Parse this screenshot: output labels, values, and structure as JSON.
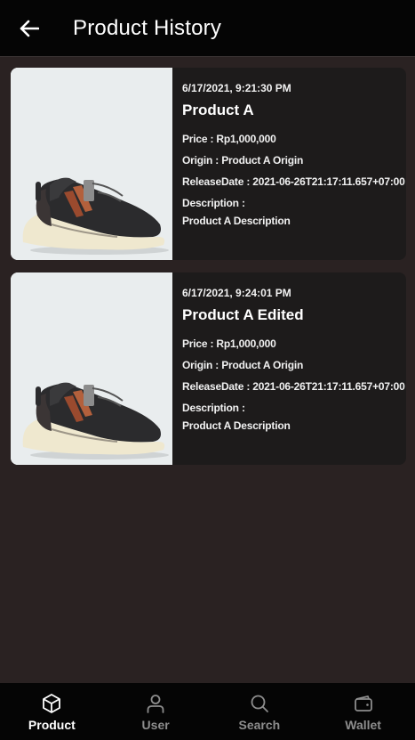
{
  "header": {
    "title": "Product History",
    "back_icon": "arrow-left-icon"
  },
  "labels": {
    "price": "Price : ",
    "origin": "Origin : ",
    "release_date": "ReleaseDate : ",
    "description": "Description :"
  },
  "history": [
    {
      "timestamp": "6/17/2021, 9:21:30 PM",
      "name": "Product A",
      "price": "Rp1,000,000",
      "origin": "Product A Origin",
      "release_date": "2021-06-26T21:17:11.657+07:00",
      "description": "Product A Description",
      "image": "sneaker-image"
    },
    {
      "timestamp": "6/17/2021, 9:24:01 PM",
      "name": "Product A Edited",
      "price": "Rp1,000,000",
      "origin": "Product A Origin",
      "release_date": "2021-06-26T21:17:11.657+07:00",
      "description": "Product A Description",
      "image": "sneaker-image"
    }
  ],
  "nav": [
    {
      "label": "Product",
      "icon": "cube-icon",
      "active": true
    },
    {
      "label": "User",
      "icon": "user-icon",
      "active": false
    },
    {
      "label": "Search",
      "icon": "search-icon",
      "active": false
    },
    {
      "label": "Wallet",
      "icon": "wallet-icon",
      "active": false
    }
  ],
  "colors": {
    "background": "#2a2222",
    "bar": "#050505",
    "card": "#1d1b1b",
    "image_bg": "#e9edee",
    "nav_active": "#ffffff",
    "nav_inactive": "#8d8d8d"
  }
}
